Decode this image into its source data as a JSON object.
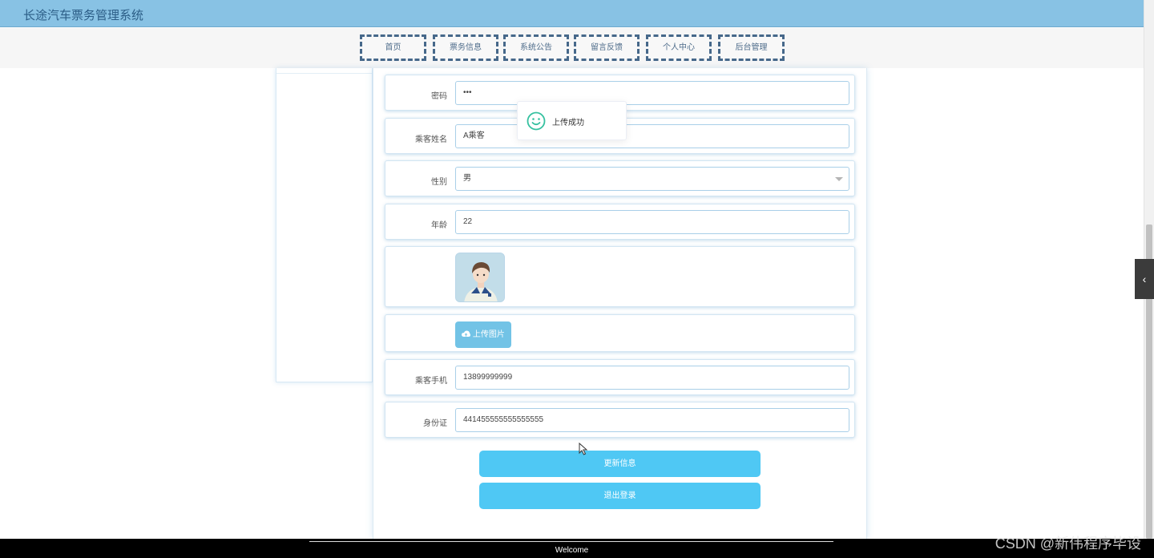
{
  "header": {
    "app_title": "长途汽车票务管理系统"
  },
  "nav": {
    "items": [
      {
        "label": "首页"
      },
      {
        "label": "票务信息"
      },
      {
        "label": "系统公告"
      },
      {
        "label": "留言反馈"
      },
      {
        "label": "个人中心"
      },
      {
        "label": "后台管理"
      }
    ]
  },
  "form": {
    "password": {
      "label": "密码",
      "value": "•••"
    },
    "name": {
      "label": "乘客姓名",
      "value": "A乘客"
    },
    "gender": {
      "label": "性别",
      "value": "男"
    },
    "age": {
      "label": "年龄",
      "value": "22"
    },
    "upload_button": "上传图片",
    "phone": {
      "label": "乘客手机",
      "value": "13899999999"
    },
    "id_card": {
      "label": "身份证",
      "value": "441455555555555555"
    }
  },
  "actions": {
    "update": "更新信息",
    "logout": "退出登录"
  },
  "toast": {
    "message": "上传成功"
  },
  "footer": {
    "text": "Welcome"
  },
  "watermark": "CSDN @新伟程序毕设",
  "colors": {
    "topbar": "#88c2e4",
    "button": "#4fc8f4",
    "upload_button": "#72c3e6",
    "toast_icon": "#36c1a0"
  }
}
